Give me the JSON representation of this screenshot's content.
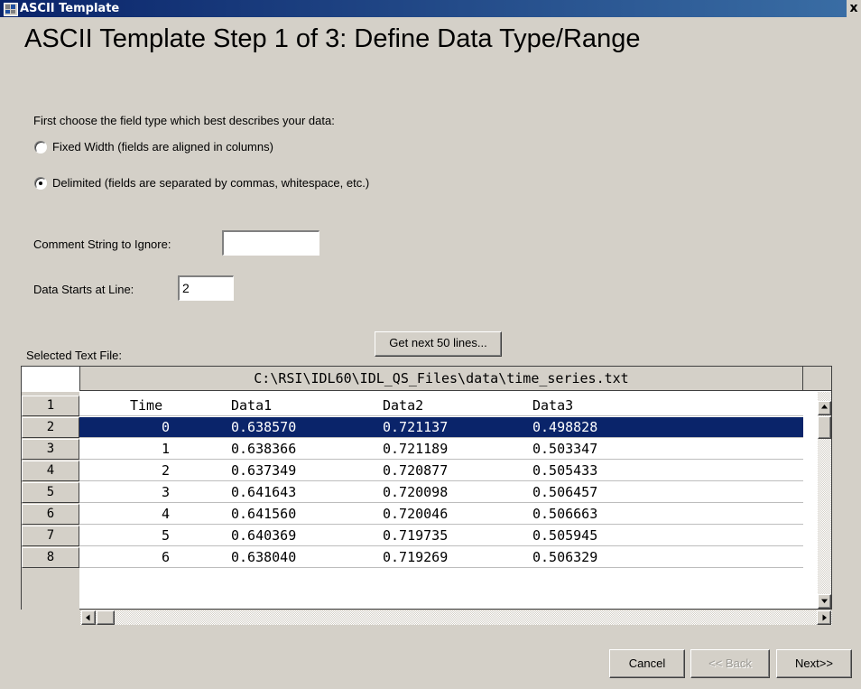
{
  "window": {
    "title": "ASCII Template",
    "close_label": "x"
  },
  "heading": "ASCII Template Step 1 of 3: Define Data Type/Range",
  "field_type": {
    "prompt": "First choose the field type which best describes your data:",
    "options": [
      {
        "label": "Fixed Width  (fields are aligned in columns)",
        "selected": false
      },
      {
        "label": "Delimited  (fields are separated by commas, whitespace, etc.)",
        "selected": true
      }
    ]
  },
  "comment": {
    "label": "Comment String to Ignore:",
    "value": ""
  },
  "data_start": {
    "label": "Data Starts at Line:",
    "value": "2"
  },
  "file_section": {
    "label": "Selected Text File:",
    "next_lines_button": "Get next 50 lines...",
    "file_path": "C:\\RSI\\IDL60\\IDL_QS_Files\\data\\time_series.txt"
  },
  "grid": {
    "selected_row": "2",
    "rows": [
      {
        "num": "1",
        "cells": [
          "Time",
          "Data1",
          "Data2",
          "Data3"
        ]
      },
      {
        "num": "2",
        "cells": [
          "0",
          "0.638570",
          "0.721137",
          "0.498828"
        ]
      },
      {
        "num": "3",
        "cells": [
          "1",
          "0.638366",
          "0.721189",
          "0.503347"
        ]
      },
      {
        "num": "4",
        "cells": [
          "2",
          "0.637349",
          "0.720877",
          "0.505433"
        ]
      },
      {
        "num": "5",
        "cells": [
          "3",
          "0.641643",
          "0.720098",
          "0.506457"
        ]
      },
      {
        "num": "6",
        "cells": [
          "4",
          "0.641560",
          "0.720046",
          "0.506663"
        ]
      },
      {
        "num": "7",
        "cells": [
          "5",
          "0.640369",
          "0.719735",
          "0.505945"
        ]
      },
      {
        "num": "8",
        "cells": [
          "6",
          "0.638040",
          "0.719269",
          "0.506329"
        ]
      }
    ]
  },
  "buttons": {
    "cancel": "Cancel",
    "back": "<< Back",
    "next": "Next>>"
  },
  "colors": {
    "selection": "#0a246a",
    "dialog_bg": "#d4d0c8"
  }
}
